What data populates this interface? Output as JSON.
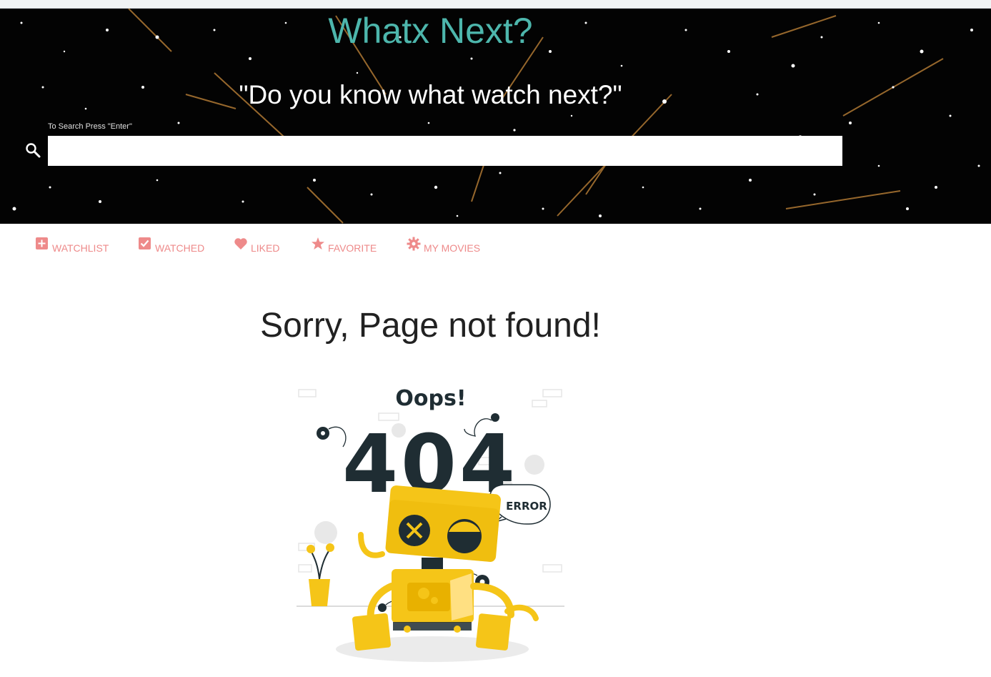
{
  "header": {
    "title": "Whatx Next?",
    "tagline": "\"Do you know what watch next?\""
  },
  "search": {
    "hint": "To Search Press \"Enter\"",
    "value": "",
    "placeholder": ""
  },
  "nav": {
    "items": [
      {
        "label": "WATCHLIST",
        "icon": "plus-box-icon"
      },
      {
        "label": "WATCHED",
        "icon": "check-box-icon"
      },
      {
        "label": "LIKED",
        "icon": "heart-icon"
      },
      {
        "label": "FAVORITE",
        "icon": "star-icon"
      },
      {
        "label": "MY MOVIES",
        "icon": "gear-icon"
      }
    ]
  },
  "main": {
    "message": "Sorry, Page not found!",
    "illustration": {
      "heading": "Oops!",
      "code": "404",
      "bubble": "ERROR"
    }
  },
  "colors": {
    "title": "#4db6ac",
    "nav": "#ee8a8a",
    "robot": "#f5c518",
    "dark": "#1f2d33"
  }
}
